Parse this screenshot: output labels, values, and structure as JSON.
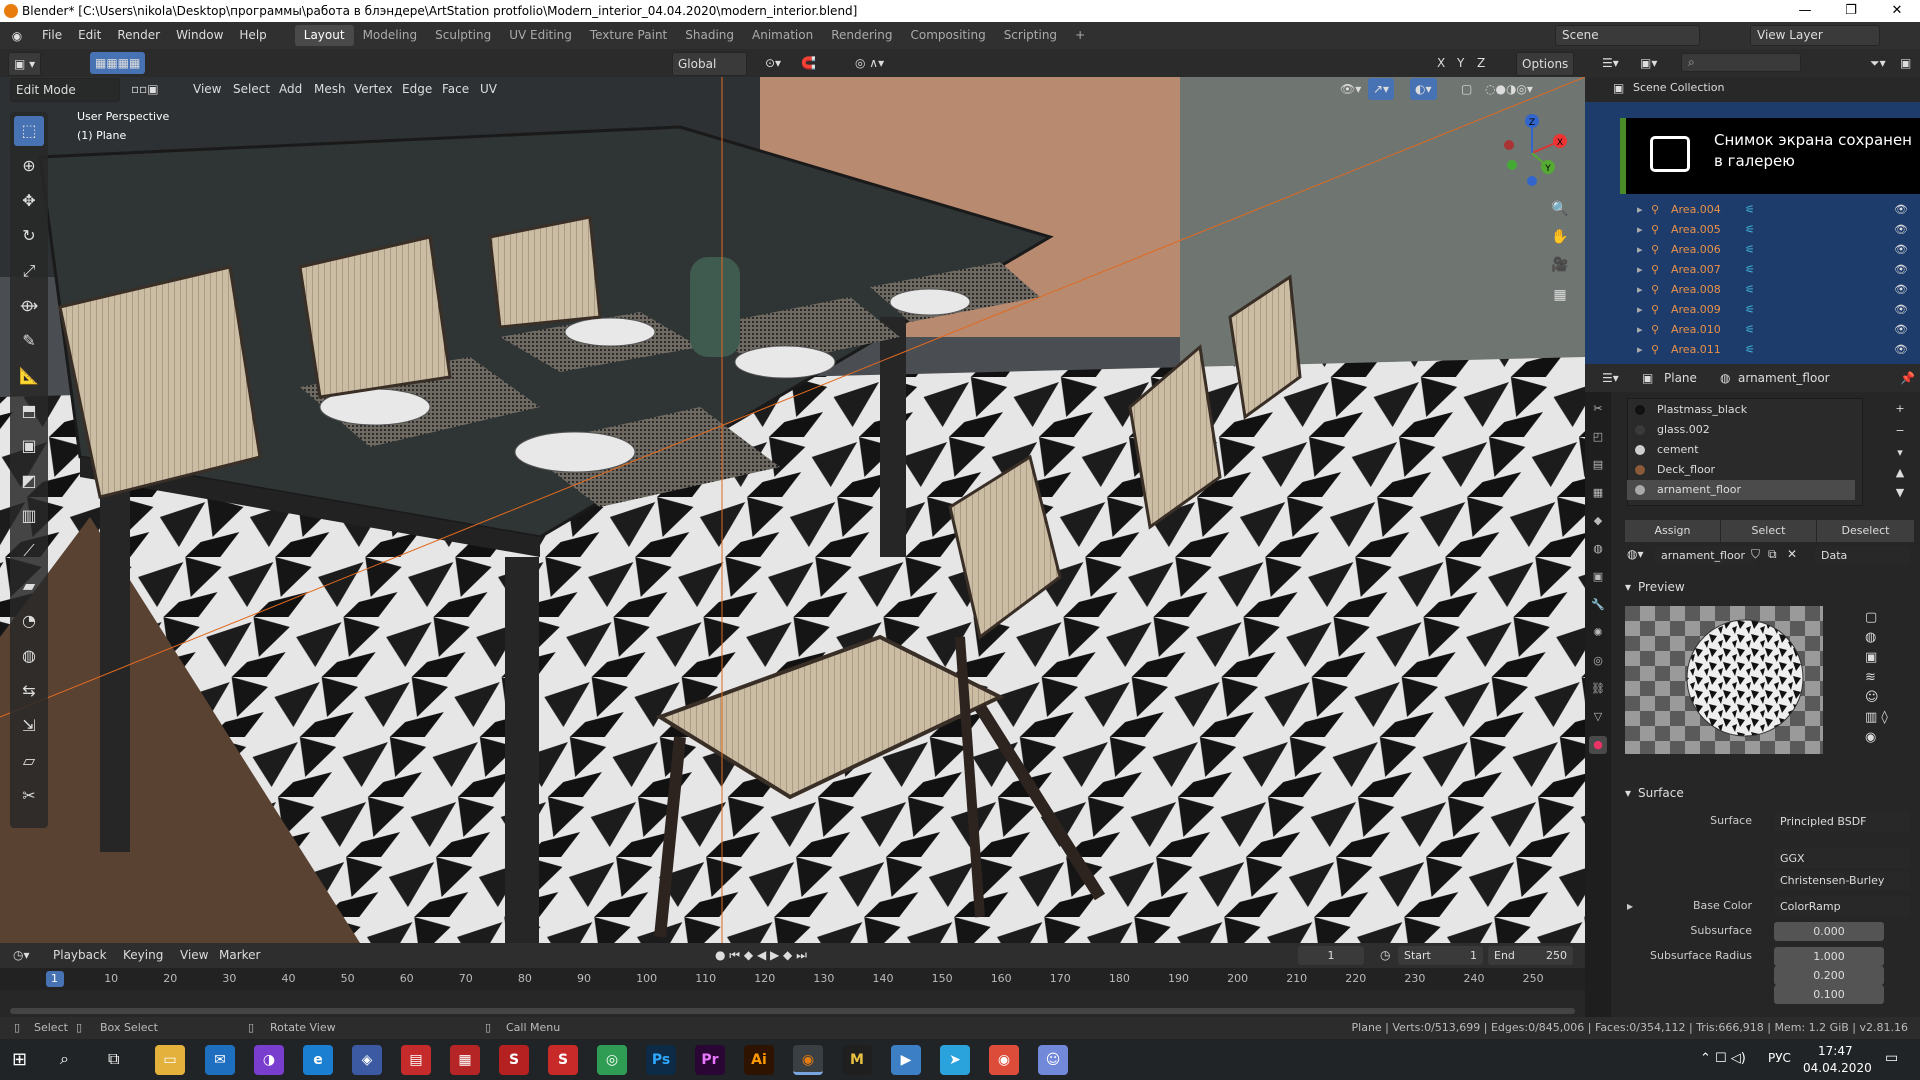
{
  "window": {
    "title": "Blender* [C:\\Users\\nikola\\Desktop\\программы\\работа в блэндере\\ArtStation protfolio\\Modern_interior_04.04.2020\\modern_interior.blend]",
    "minimize": "—",
    "maximize": "❐",
    "close": "✕"
  },
  "menu": [
    "File",
    "Edit",
    "Render",
    "Window",
    "Help"
  ],
  "workspaces": [
    "Layout",
    "Modeling",
    "Sculpting",
    "UV Editing",
    "Texture Paint",
    "Shading",
    "Animation",
    "Rendering",
    "Compositing",
    "Scripting"
  ],
  "active_workspace": "Layout",
  "scene": {
    "name": "Scene",
    "view_layer": "View Layer"
  },
  "viewport_header": {
    "mode": "Edit Mode",
    "menus": [
      "View",
      "Select",
      "Add",
      "Mesh",
      "Vertex",
      "Edge",
      "Face",
      "UV"
    ],
    "transform_orientation": "Global",
    "options": "Options",
    "axes": [
      "X",
      "Y",
      "Z"
    ]
  },
  "viewport": {
    "perspective": "User Perspective",
    "object": "(1) Plane"
  },
  "gizmo": {
    "x": "X",
    "y": "Y",
    "z": "Z"
  },
  "tools": [
    "select-box",
    "cursor",
    "move",
    "rotate",
    "scale",
    "transform",
    "annotate",
    "measure",
    "extrude",
    "inset",
    "bevel",
    "loop-cut",
    "knife",
    "poly-build",
    "spin",
    "smooth",
    "edge-slide",
    "shrink",
    "shear",
    "rip"
  ],
  "timeline": {
    "menus": [
      "Playback",
      "Keying",
      "View",
      "Marker"
    ],
    "current_frame": "1",
    "start_label": "Start",
    "start": "1",
    "end_label": "End",
    "end": "250",
    "ticks": [
      "1",
      "10",
      "20",
      "30",
      "40",
      "50",
      "60",
      "70",
      "80",
      "90",
      "100",
      "110",
      "120",
      "130",
      "140",
      "150",
      "160",
      "170",
      "180",
      "190",
      "200",
      "210",
      "220",
      "230",
      "240",
      "250"
    ]
  },
  "status": {
    "select": "Select",
    "box_select": "Box Select",
    "rotate_view": "Rotate View",
    "call_menu": "Call Menu",
    "stats": "Plane | Verts:0/513,699 | Edges:0/845,006 | Faces:0/354,112 | Tris:666,918 | Mem: 1.2 GiB | v2.81.16"
  },
  "outliner": {
    "title": "Scene Collection",
    "items": [
      "Area.004",
      "Area.005",
      "Area.006",
      "Area.007",
      "Area.008",
      "Area.009",
      "Area.010",
      "Area.011"
    ]
  },
  "toast": {
    "text": "Снимок экрана сохранен в галерею"
  },
  "properties": {
    "object": "Plane",
    "material": "arnament_floor",
    "slots": [
      {
        "name": "Plastmass_black",
        "color": "#111111"
      },
      {
        "name": "glass.002",
        "color": "#3a3a3a"
      },
      {
        "name": "cement",
        "color": "#cfcfcf"
      },
      {
        "name": "Deck_floor",
        "color": "#8a5a3a"
      },
      {
        "name": "arnament_floor",
        "color": "#aaaaaa"
      }
    ],
    "assign": "Assign",
    "select": "Select",
    "deselect": "Deselect",
    "link": "Data",
    "preview_label": "Preview",
    "surface_section": "Surface",
    "surface_label": "Surface",
    "surface_value": "Principled BSDF",
    "distribution": "GGX",
    "subsurface_method": "Christensen-Burley",
    "base_color_label": "Base Color",
    "base_color_value": "ColorRamp",
    "subsurface_label": "Subsurface",
    "subsurface_value": "0.000",
    "subsurface_radius_label": "Subsurface Radius",
    "radius": [
      "1.000",
      "0.200",
      "0.100"
    ]
  },
  "taskbar": {
    "lang": "РУС",
    "time": "17:47",
    "date": "04.04.2020"
  }
}
